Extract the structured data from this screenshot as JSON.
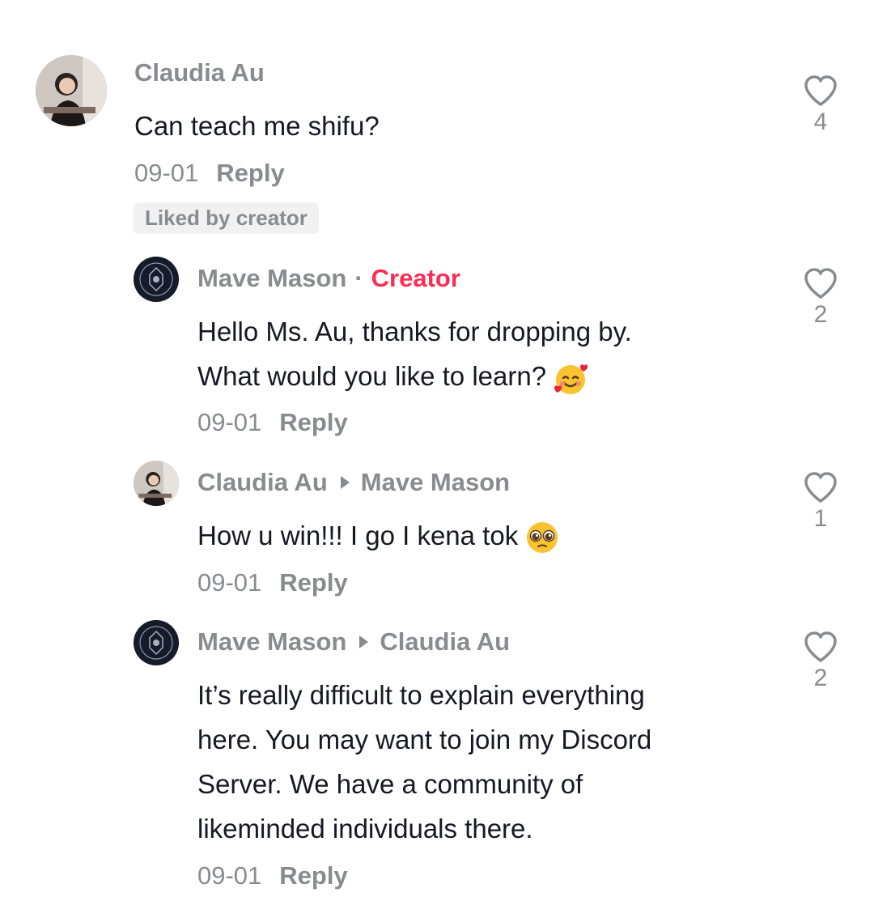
{
  "comments": [
    {
      "author": "Claudia Au",
      "text": "Can teach me shifu?",
      "date": "09-01",
      "reply_label": "Reply",
      "liked_by_creator": "Liked by creator",
      "likes": "4"
    },
    {
      "author": "Mave Mason",
      "creator_label": "Creator",
      "text_line1": "Hello Ms. Au, thanks for dropping by.",
      "text_line2": "What would you like to learn?",
      "date": "09-01",
      "reply_label": "Reply",
      "likes": "2"
    },
    {
      "author": "Claudia Au",
      "reply_to": "Mave Mason",
      "text": "How u win!!! I go I kena tok",
      "date": "09-01",
      "reply_label": "Reply",
      "likes": "1"
    },
    {
      "author": "Mave Mason",
      "reply_to": "Claudia Au",
      "text_lines": [
        "It’s really difficult to explain everything",
        "here. You may want to join my Discord",
        "Server. We have a community of",
        "likeminded individuals there."
      ],
      "date": "09-01",
      "reply_label": "Reply",
      "likes": "2"
    }
  ],
  "icons": {
    "like": "heart-outline-icon",
    "close": "close-icon"
  },
  "colors": {
    "creator": "#fe2c55",
    "muted": "#8a8b91",
    "text": "#161823"
  }
}
